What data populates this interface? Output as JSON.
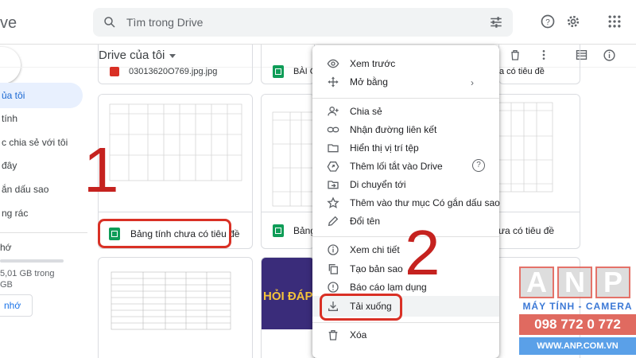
{
  "header": {
    "logo_text": "ve",
    "search_placeholder": "Tìm trong Drive",
    "icons": [
      "search-icon",
      "tune-icon",
      "help-icon",
      "settings-icon",
      "apps-icon"
    ]
  },
  "sidebar": {
    "items": [
      {
        "label": "ủa tôi",
        "active": true
      },
      {
        "label": "tính"
      },
      {
        "label": "c chia sẻ với tôi"
      },
      {
        "label": "đây"
      },
      {
        "label": "ắn dấu sao"
      },
      {
        "label": "ng rác"
      }
    ],
    "storage_label": "hớ",
    "storage_used": "5,01 GB trong",
    "storage_total": "GB",
    "buy_label": "nhớ"
  },
  "main": {
    "breadcrumb": "Drive của tôi",
    "top_strip_items": [
      {
        "name": "03013620O769.jpg.jpg"
      },
      {
        "name": "BÀI G"
      },
      {
        "name": "a có tiêu đề"
      }
    ],
    "cards": [
      {
        "name": "Bảng tính chưa có tiêu đề"
      },
      {
        "name": "Bảng"
      },
      {
        "name": "ưa có tiêu đề"
      }
    ],
    "thumb_text": "HỎI ĐÁP"
  },
  "context_menu": {
    "items": [
      {
        "label": "Xem trước",
        "icon": "eye-icon"
      },
      {
        "label": "Mở bằng",
        "icon": "move-icon",
        "submenu": true
      },
      {
        "label": "Chia sẻ",
        "icon": "person-add-icon"
      },
      {
        "label": "Nhận đường liên kết",
        "icon": "link-icon"
      },
      {
        "label": "Hiển thị vị trí tệp",
        "icon": "folder-icon"
      },
      {
        "label": "Thêm lối tắt vào Drive",
        "icon": "shortcut-icon",
        "help": true
      },
      {
        "label": "Di chuyển tới",
        "icon": "move-to-icon"
      },
      {
        "label": "Thêm vào thư mục Có gắn dấu sao",
        "icon": "star-icon"
      },
      {
        "label": "Đổi tên",
        "icon": "pencil-icon"
      },
      {
        "label": "Xem chi tiết",
        "icon": "info-icon"
      },
      {
        "label": "Tạo bản sao",
        "icon": "copy-icon"
      },
      {
        "label": "Báo cáo lạm dụng",
        "icon": "report-icon"
      },
      {
        "label": "Tải xuống",
        "icon": "download-icon",
        "highlighted": true
      },
      {
        "label": "Xóa",
        "icon": "trash-icon"
      }
    ]
  },
  "annotations": {
    "step1": "1",
    "step2": "2"
  },
  "watermark": {
    "letters": [
      "A",
      "N",
      "P"
    ],
    "subtitle": "MÁY TÍNH - CAMERA",
    "phone": "098 772 0 772",
    "url": "WWW.ANP.COM.VN"
  }
}
